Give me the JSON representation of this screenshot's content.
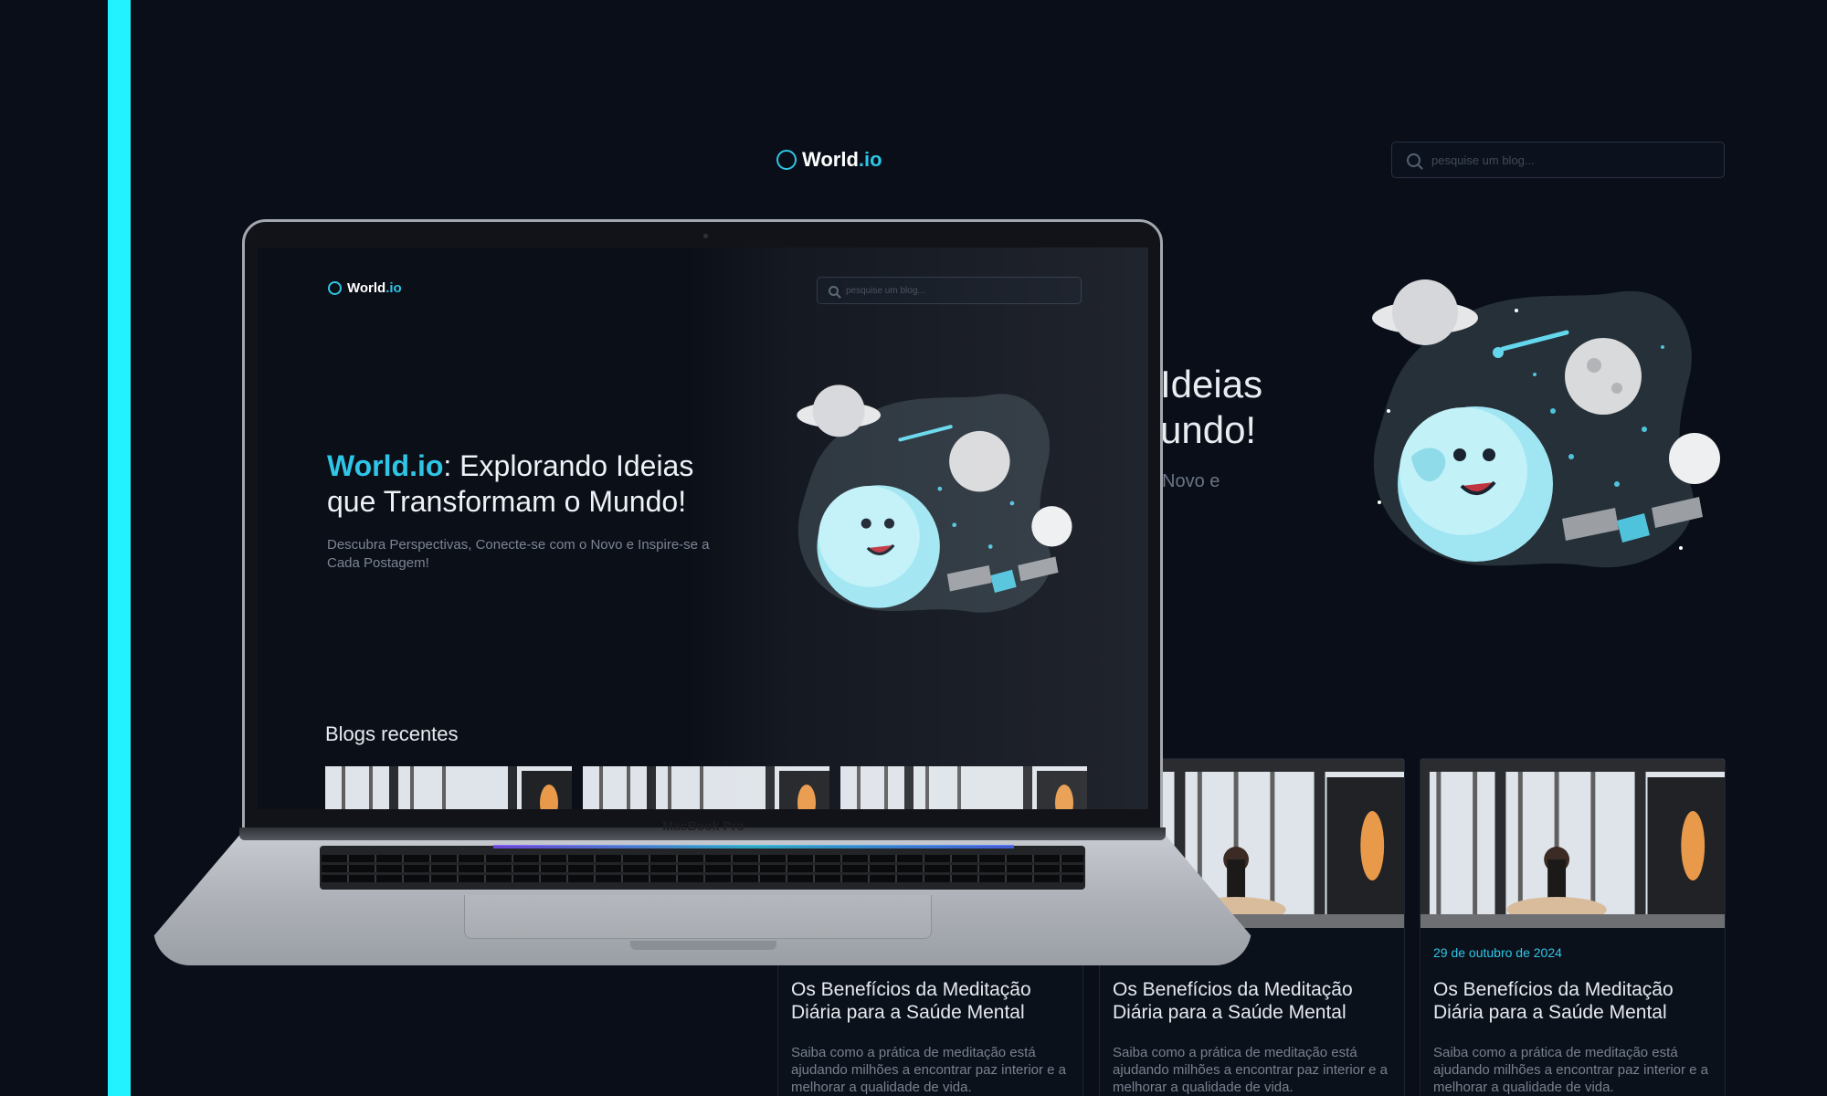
{
  "brand": {
    "name": "World",
    "suffix": ".io",
    "accent": "#2fc5e6",
    "bar_color": "#22f2ff"
  },
  "search": {
    "placeholder": "pesquise um blog..."
  },
  "background_hero": {
    "line1": "Ideias",
    "line2": "undo!",
    "sub": "Novo e"
  },
  "cards": [
    {
      "date": "",
      "title": "Os Benefícios da Meditação Diária para a Saúde Mental",
      "excerpt": "Saiba como a prática de meditação está ajudando milhões a encontrar paz interior e a melhorar a qualidade de vida."
    },
    {
      "date": "",
      "title": "Os Benefícios da Meditação Diária para a Saúde Mental",
      "excerpt": "Saiba como a prática de meditação está ajudando milhões a encontrar paz interior e a melhorar a qualidade de vida."
    },
    {
      "date": "29 de outubro de 2024",
      "title": "Os Benefícios da Meditação Diária para a Saúde Mental",
      "excerpt": "Saiba como a prática de meditação está ajudando milhões a encontrar paz interior e a melhorar a qualidade de vida."
    }
  ],
  "screen": {
    "hero_brand": "World.io",
    "hero_rest_line1": ": Explorando Ideias",
    "hero_line2": "que Transformam o Mundo!",
    "hero_sub": "Descubra Perspectivas, Conecte-se com o Novo e Inspire-se a Cada Postagem!",
    "recent_heading": "Blogs recentes"
  },
  "laptop": {
    "model": "MacBook Pro"
  },
  "icons": [
    "world-logo-icon",
    "search-icon",
    "planet-illustration",
    "meditation-photo"
  ]
}
